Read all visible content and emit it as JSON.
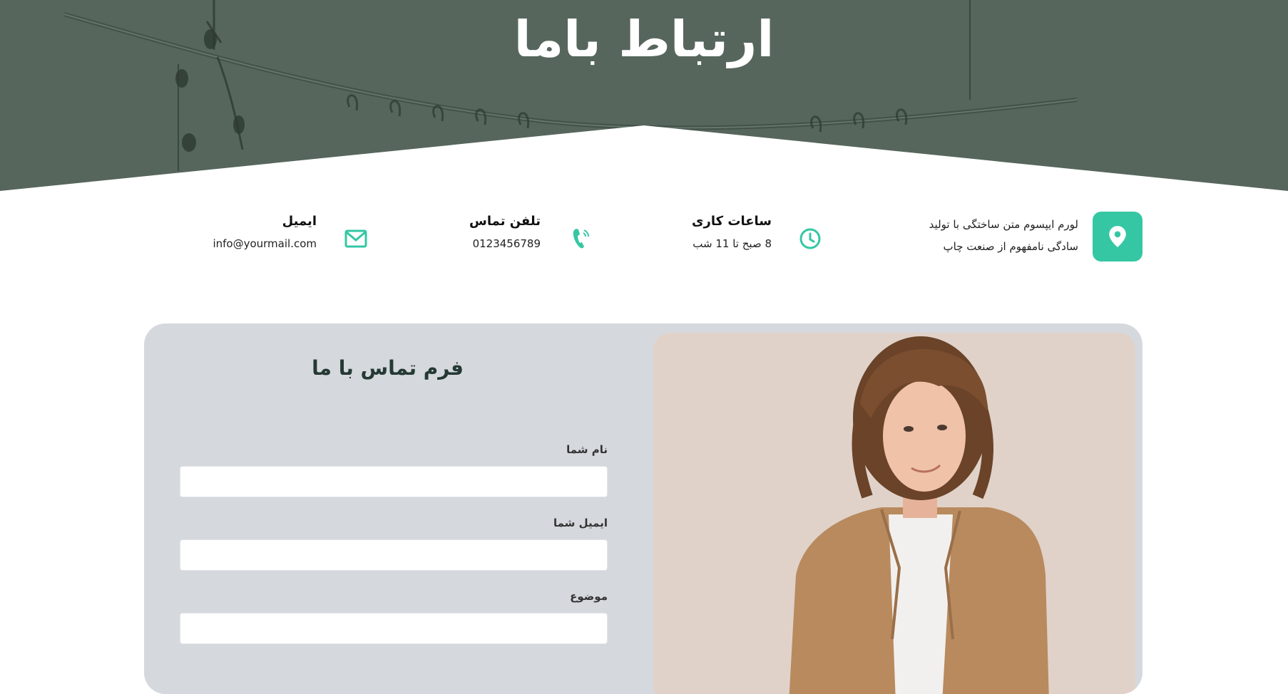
{
  "hero": {
    "title": "ارتباط باما"
  },
  "info": {
    "address_line1": "لورم ایپسوم متن ساختگی با تولید",
    "address_line2": "سادگی نامفهوم از صنعت چاپ",
    "hours_title": "ساعات کاری",
    "hours_value": "8 صبح تا 11 شب",
    "phone_title": "تلفن تماس",
    "phone_value": "0123456789",
    "email_title": "ایمیل",
    "email_value": "info@yourmail.com"
  },
  "form": {
    "title": "فرم تماس با ما",
    "name_label": "نام شما",
    "email_label": "ایمیل شما",
    "subject_label": "موضوع",
    "name_value": "",
    "email_value": "",
    "subject_value": ""
  },
  "icons": {
    "location": "map-pin-icon",
    "hours": "clock-icon",
    "phone": "phone-icon",
    "email": "envelope-icon"
  },
  "colors": {
    "hero_bg": "#5b6d62",
    "accent": "#35c7a4",
    "card_bg": "#d5d8dd",
    "form_title": "#243a33"
  }
}
